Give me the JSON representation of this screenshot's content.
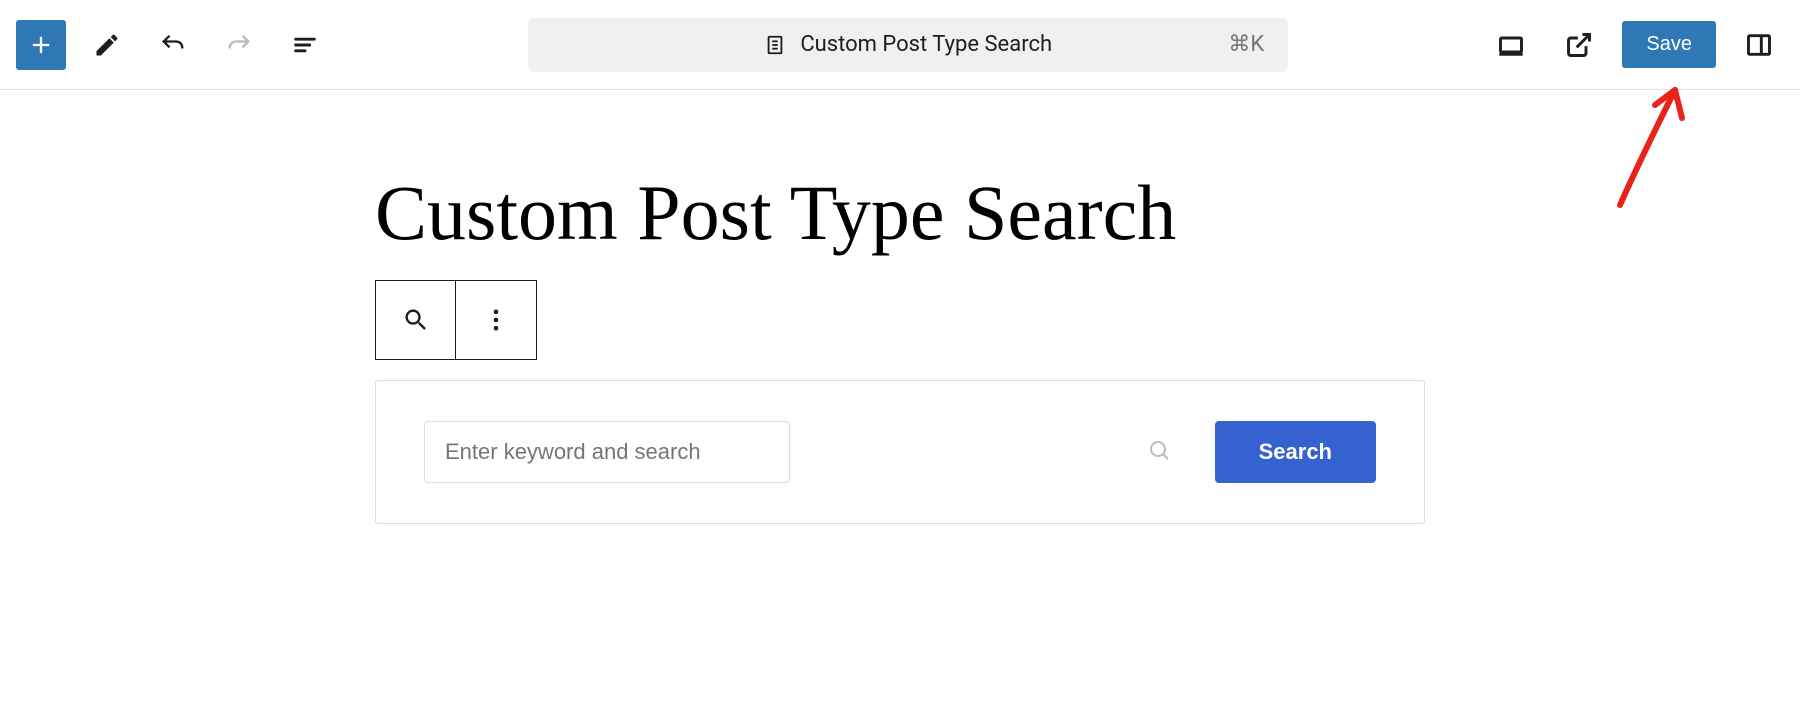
{
  "toolbar": {
    "command_center": {
      "title": "Custom Post Type Search",
      "shortcut": "⌘K"
    },
    "save_label": "Save"
  },
  "page": {
    "title": "Custom Post Type Search"
  },
  "search_block": {
    "placeholder": "Enter keyword and search",
    "button_label": "Search"
  }
}
